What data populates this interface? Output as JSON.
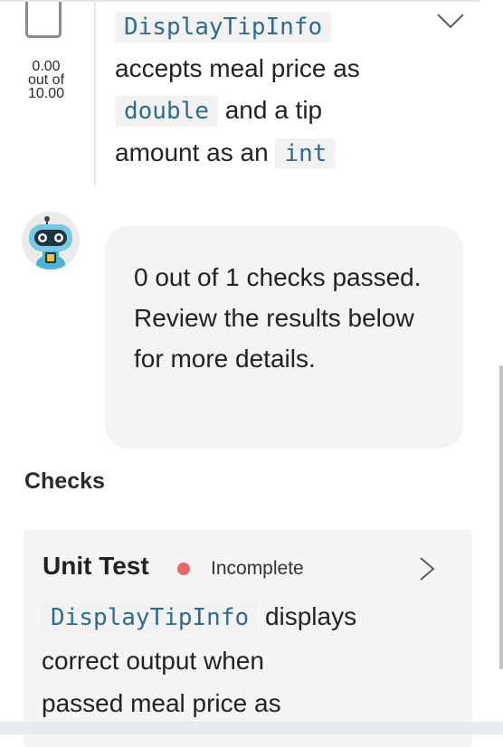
{
  "criterion": {
    "score_value": "0.00",
    "score_out_of": "out of",
    "score_max": "10.00",
    "code_method": "DisplayTipInfo",
    "text_1": "accepts meal price as",
    "code_type_1": "double",
    "text_2": "and a tip",
    "text_3": "amount as an",
    "code_type_2": "int"
  },
  "bot_message": "0 out of 1 checks passed. Review the results below for more details.",
  "checks": {
    "heading": "Checks",
    "items": [
      {
        "title": "Unit Test",
        "status": "Incomplete",
        "status_color": "#e8676a",
        "code": "DisplayTipInfo",
        "desc_1": "displays",
        "desc_2": "correct output when",
        "desc_3": "passed meal price as"
      }
    ]
  },
  "icons": {
    "expand": "chevron-down-icon",
    "open_check": "chevron-right-icon",
    "avatar": "robot-avatar-icon"
  }
}
